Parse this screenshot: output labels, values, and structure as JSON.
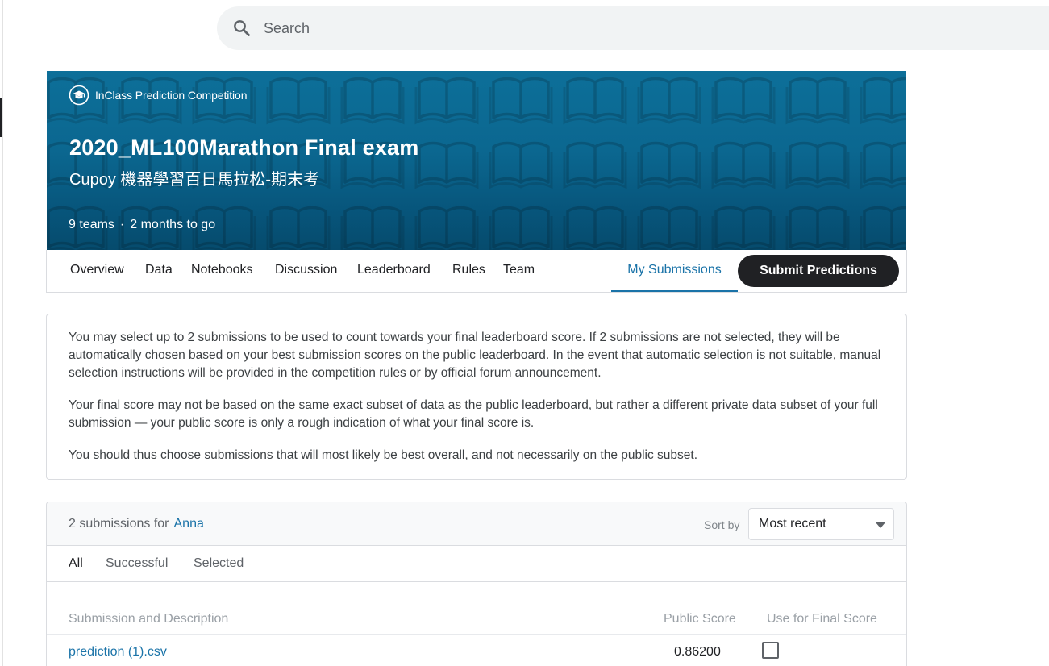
{
  "search": {
    "placeholder": "Search"
  },
  "banner": {
    "competition_type": "InClass Prediction Competition",
    "title": "2020_ML100Marathon Final exam",
    "subtitle": "Cupoy 機器學習百日馬拉松-期末考",
    "teams": "9 teams",
    "separator": "·",
    "time_left": "2 months to go"
  },
  "tabs": {
    "overview": "Overview",
    "data": "Data",
    "notebooks": "Notebooks",
    "discussion": "Discussion",
    "leaderboard": "Leaderboard",
    "rules": "Rules",
    "team": "Team",
    "my_submissions": "My Submissions",
    "submit": "Submit Predictions"
  },
  "notice": {
    "p1": "You may select up to 2 submissions to be used to count towards your final leaderboard score. If 2 submissions are not selected, they will be automatically chosen based on your best submission scores on the public leaderboard. In the event that automatic selection is not suitable, manual selection instructions will be provided in the competition rules or by official forum announcement.",
    "p2": "Your final score may not be based on the same exact subset of data as the public leaderboard, but rather a different private data subset of your full submission — your public score is only a rough indication of what your final score is.",
    "p3": "You should thus choose submissions that will most likely be best overall, and not necessarily on the public subset."
  },
  "submissions": {
    "count_text": "2 submissions for",
    "user": "Anna",
    "sort_label": "Sort by",
    "sort_value": "Most recent",
    "filters": {
      "all": "All",
      "successful": "Successful",
      "selected": "Selected"
    },
    "columns": {
      "description": "Submission and Description",
      "public_score": "Public Score",
      "use_final": "Use for Final Score"
    },
    "rows": [
      {
        "file": "prediction (1).csv",
        "score": "0.86200",
        "selected": false
      }
    ]
  },
  "colors": {
    "banner": "#0b6790",
    "accent": "#1a73a8",
    "submit_button": "#202124",
    "search_bg": "#f1f3f4"
  },
  "icons": {
    "search": "search-icon",
    "competition": "graduation-cap-icon",
    "sort": "caret-down-icon",
    "banner_pattern": "open-book-icon"
  }
}
